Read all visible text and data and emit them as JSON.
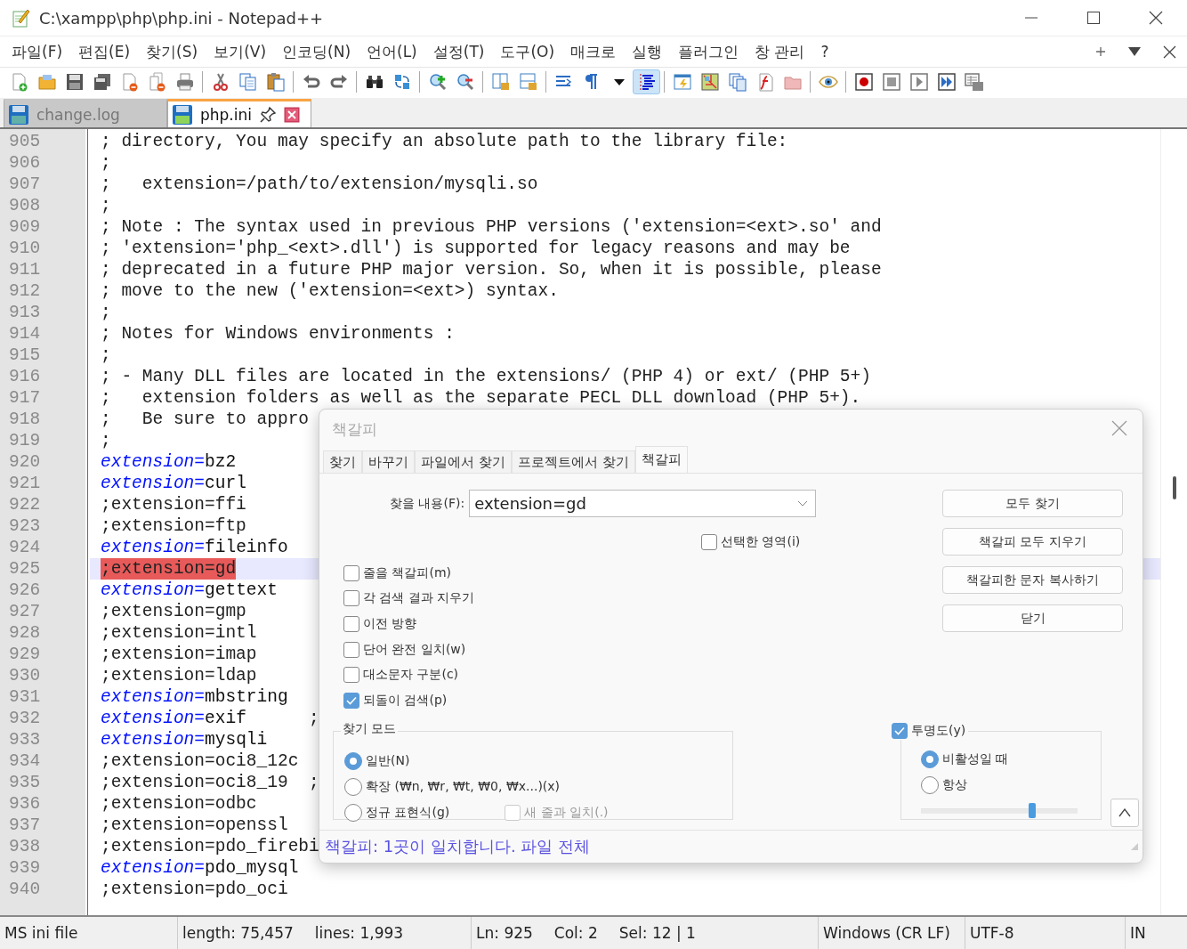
{
  "window": {
    "title": "C:\\xampp\\php\\php.ini - Notepad++"
  },
  "menu": [
    {
      "label": "파일(F)"
    },
    {
      "label": "편집(E)"
    },
    {
      "label": "찾기(S)"
    },
    {
      "label": "보기(V)"
    },
    {
      "label": "인코딩(N)"
    },
    {
      "label": "언어(L)"
    },
    {
      "label": "설정(T)"
    },
    {
      "label": "도구(O)"
    },
    {
      "label": "매크로"
    },
    {
      "label": "실행"
    },
    {
      "label": "플러그인"
    },
    {
      "label": "창 관리"
    },
    {
      "label": "?"
    }
  ],
  "toolbar": [
    {
      "kind": "new",
      "pressed": false
    },
    {
      "kind": "open",
      "pressed": false
    },
    {
      "kind": "save",
      "pressed": false
    },
    {
      "kind": "save-all",
      "pressed": false
    },
    {
      "kind": "close",
      "pressed": false
    },
    {
      "kind": "close-all",
      "pressed": false
    },
    {
      "kind": "print",
      "pressed": false
    },
    {
      "kind": "separator"
    },
    {
      "kind": "cut",
      "pressed": false
    },
    {
      "kind": "copy",
      "pressed": false
    },
    {
      "kind": "paste",
      "pressed": false
    },
    {
      "kind": "separator"
    },
    {
      "kind": "undo",
      "pressed": false
    },
    {
      "kind": "redo",
      "pressed": false
    },
    {
      "kind": "separator"
    },
    {
      "kind": "find",
      "pressed": false
    },
    {
      "kind": "replace",
      "pressed": false
    },
    {
      "kind": "separator"
    },
    {
      "kind": "zoom-in",
      "pressed": false
    },
    {
      "kind": "zoom-out",
      "pressed": false
    },
    {
      "kind": "separator"
    },
    {
      "kind": "sync-v",
      "pressed": false
    },
    {
      "kind": "sync-h",
      "pressed": false
    },
    {
      "kind": "separator"
    },
    {
      "kind": "wrap",
      "pressed": false
    },
    {
      "kind": "pilcrow",
      "pressed": false
    },
    {
      "kind": "caret",
      "pressed": false
    },
    {
      "kind": "indent",
      "pressed": true
    },
    {
      "kind": "separator"
    },
    {
      "kind": "udl",
      "pressed": false
    },
    {
      "kind": "docmap",
      "pressed": false
    },
    {
      "kind": "doclist",
      "pressed": false
    },
    {
      "kind": "funclist",
      "pressed": false
    },
    {
      "kind": "workspace",
      "pressed": false
    },
    {
      "kind": "separator"
    },
    {
      "kind": "monitor",
      "pressed": false
    },
    {
      "kind": "separator"
    },
    {
      "kind": "record",
      "pressed": false
    },
    {
      "kind": "stop",
      "pressed": false
    },
    {
      "kind": "play",
      "pressed": false
    },
    {
      "kind": "play-multi",
      "pressed": false
    },
    {
      "kind": "save-macro",
      "pressed": false
    }
  ],
  "tabs": [
    {
      "label": "change.log",
      "selected": false
    },
    {
      "label": "php.ini",
      "selected": true
    }
  ],
  "editor": {
    "lines": [
      {
        "n": "905",
        "kind": "comment",
        "text": "; directory, You may specify an absolute path to the library file:",
        "current": false
      },
      {
        "n": "906",
        "kind": "comment",
        "text": ";",
        "current": false
      },
      {
        "n": "907",
        "kind": "comment",
        "text": ";   extension=/path/to/extension/mysqli.so",
        "current": false
      },
      {
        "n": "908",
        "kind": "comment",
        "text": ";",
        "current": false
      },
      {
        "n": "909",
        "kind": "comment",
        "text": "; Note : The syntax used in previous PHP versions ('extension=<ext>.so' and",
        "current": false
      },
      {
        "n": "910",
        "kind": "comment",
        "text": "; 'extension='php_<ext>.dll') is supported for legacy reasons and may be",
        "current": false
      },
      {
        "n": "911",
        "kind": "comment",
        "text": "; deprecated in a future PHP major version. So, when it is possible, please",
        "current": false
      },
      {
        "n": "912",
        "kind": "comment",
        "text": "; move to the new ('extension=<ext>) syntax.",
        "current": false
      },
      {
        "n": "913",
        "kind": "comment",
        "text": ";",
        "current": false
      },
      {
        "n": "914",
        "kind": "comment",
        "text": "; Notes for Windows environments :",
        "current": false
      },
      {
        "n": "915",
        "kind": "comment",
        "text": ";",
        "current": false
      },
      {
        "n": "916",
        "kind": "comment",
        "text": "; - Many DLL files are located in the extensions/ (PHP 4) or ext/ (PHP 5+)",
        "current": false
      },
      {
        "n": "917",
        "kind": "comment",
        "text": ";   extension folders as well as the separate PECL DLL download (PHP 5+).",
        "current": false
      },
      {
        "n": "918",
        "kind": "comment",
        "text": ";   Be sure to appro",
        "current": false
      },
      {
        "n": "919",
        "kind": "comment",
        "text": ";",
        "current": false
      },
      {
        "n": "920",
        "kind": "setting",
        "key": "extension=",
        "value": "bz2",
        "current": false
      },
      {
        "n": "921",
        "kind": "setting",
        "key": "extension=",
        "value": "curl",
        "current": false
      },
      {
        "n": "922",
        "kind": "comment",
        "text": ";extension=ffi",
        "current": false
      },
      {
        "n": "923",
        "kind": "comment",
        "text": ";extension=ftp",
        "current": false
      },
      {
        "n": "924",
        "kind": "setting",
        "key": "extension=",
        "value": "fileinfo",
        "current": false
      },
      {
        "n": "925",
        "kind": "marked",
        "text": ";extension=gd",
        "current": true
      },
      {
        "n": "926",
        "kind": "setting",
        "key": "extension=",
        "value": "gettext",
        "current": false
      },
      {
        "n": "927",
        "kind": "comment",
        "text": ";extension=gmp",
        "current": false
      },
      {
        "n": "928",
        "kind": "comment",
        "text": ";extension=intl",
        "current": false
      },
      {
        "n": "929",
        "kind": "comment",
        "text": ";extension=imap",
        "current": false
      },
      {
        "n": "930",
        "kind": "comment",
        "text": ";extension=ldap",
        "current": false
      },
      {
        "n": "931",
        "kind": "setting",
        "key": "extension=",
        "value": "mbstring",
        "current": false
      },
      {
        "n": "932",
        "kind": "setting",
        "key": "extension=",
        "value": "exif",
        "comment": ";",
        "current": false
      },
      {
        "n": "933",
        "kind": "setting",
        "key": "extension=",
        "value": "mysqli",
        "current": false
      },
      {
        "n": "934",
        "kind": "comment",
        "text": ";extension=oci8_12c",
        "current": false
      },
      {
        "n": "935",
        "kind": "comment",
        "text": ";extension=oci8_19  ;",
        "current": false
      },
      {
        "n": "936",
        "kind": "comment",
        "text": ";extension=odbc",
        "current": false
      },
      {
        "n": "937",
        "kind": "comment",
        "text": ";extension=openssl",
        "current": false
      },
      {
        "n": "938",
        "kind": "comment",
        "text": ";extension=pdo_firebi",
        "current": false
      },
      {
        "n": "939",
        "kind": "setting",
        "key": "extension=",
        "value": "pdo_mysql",
        "current": false
      },
      {
        "n": "940",
        "kind": "comment",
        "text": ";extension=pdo_oci",
        "current": false
      }
    ]
  },
  "dialog": {
    "title": "책갈피",
    "tabs": [
      {
        "label": "찾기",
        "selected": false
      },
      {
        "label": "바꾸기",
        "selected": false
      },
      {
        "label": "파일에서 찾기",
        "selected": false
      },
      {
        "label": "프로젝트에서 찾기",
        "selected": false
      },
      {
        "label": "책갈피",
        "selected": true
      }
    ],
    "find_label": "찾을 내용(F):",
    "find_value": "extension=gd",
    "in_selection": {
      "label": "선택한 영역(i)",
      "checked": false
    },
    "buttons": [
      {
        "label": "모두 찾기"
      },
      {
        "label": "책갈피 모두 지우기"
      },
      {
        "label": "책갈피한 문자 복사하기"
      },
      {
        "label": "닫기"
      }
    ],
    "options": [
      {
        "label": "줄을 책갈피(m)",
        "checked": false
      },
      {
        "label": "각 검색 결과 지우기",
        "checked": false
      },
      {
        "label": "이전 방향",
        "checked": false
      },
      {
        "label": "단어 완전 일치(w)",
        "checked": false
      },
      {
        "label": "대소문자 구분(c)",
        "checked": false
      },
      {
        "label": "되돌이 검색(p)",
        "checked": true
      }
    ],
    "mode": {
      "title": "찾기 모드",
      "options": [
        {
          "label": "일반(N)",
          "selected": true
        },
        {
          "label": "확장 (₩n, ₩r, ₩t, ₩0, ₩x...)(x)",
          "selected": false
        },
        {
          "label": "정규 표현식(g)",
          "selected": false
        }
      ],
      "newline": {
        "label": "새 줄과 일치(.)",
        "checked": false,
        "disabled": true
      }
    },
    "transparency": {
      "label": "투명도(y)",
      "checked": true,
      "options": [
        {
          "label": "비활성일 때",
          "selected": true
        },
        {
          "label": "항상",
          "selected": false
        }
      ],
      "level": 0.71
    },
    "status": "책갈피: 1곳이 일치합니다. 파일 전체"
  },
  "status_bar": [
    "MS ini file",
    "length: 75,457",
    "lines: 1,993",
    "Ln: 925",
    "Col: 2",
    "Sel: 12 | 1",
    "Windows (CR LF)",
    "UTF-8",
    "IN"
  ]
}
